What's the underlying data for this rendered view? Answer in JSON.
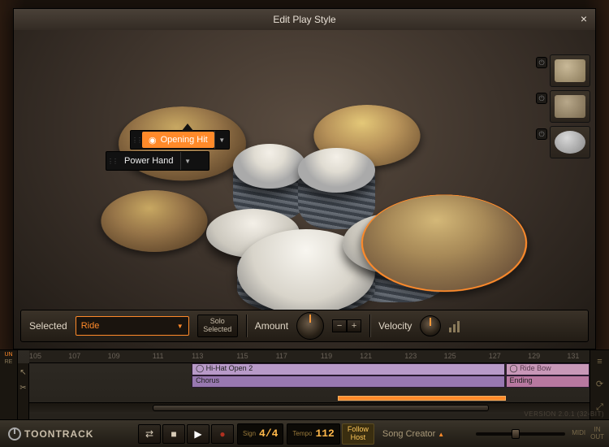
{
  "modal": {
    "title": "Edit Play Style",
    "popup": {
      "primary": "Opening Hit",
      "secondary": "Power Hand"
    },
    "ctrl": {
      "selected_label": "Selected",
      "selected_value": "Ride",
      "solo_line1": "Solo",
      "solo_line2": "Selected",
      "amount_label": "Amount",
      "velocity_label": "Velocity"
    },
    "slots": {
      "power_glyph": "⏻"
    }
  },
  "timeline": {
    "ruler": [
      "105",
      "107",
      "109",
      "111",
      "113",
      "115",
      "117",
      "119",
      "121",
      "123",
      "125",
      "127",
      "129",
      "131"
    ],
    "left": {
      "un": "UN",
      "re": "RE"
    },
    "clips": {
      "hihat": "Hi-Hat Open 2",
      "chorus": "Chorus",
      "ridebow": "Ride Bow",
      "ending": "Ending"
    }
  },
  "transport": {
    "brand": "TOONTRACK",
    "sign_label": "Sign",
    "sign_value": "4/4",
    "tempo_label": "Tempo",
    "tempo_value": "112",
    "follow_line1": "Follow",
    "follow_line2": "Host",
    "song_creator": "Song Creator",
    "midi": "MIDI",
    "in": "IN",
    "out": "OUT"
  },
  "version": "VERSION 2.0.1 (32-BIT)"
}
